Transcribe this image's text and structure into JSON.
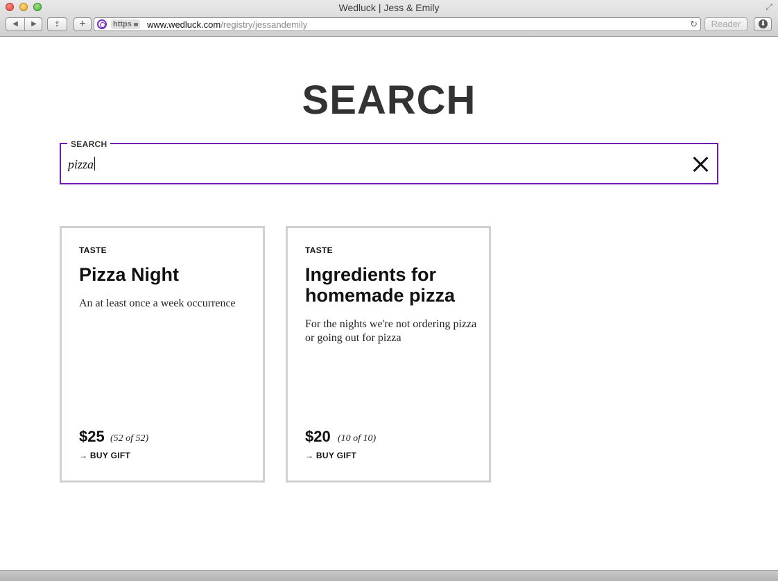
{
  "window": {
    "title": "Wedluck | Jess & Emily"
  },
  "toolbar": {
    "back_icon": "◀",
    "forward_icon": "▶",
    "share_icon": "⇪",
    "add_icon": "+",
    "https_label": "https",
    "url_host": "www.wedluck.com",
    "url_path": "/registry/jessandemily",
    "reload_icon": "↻",
    "reader_label": "Reader",
    "download_icon": "⬇",
    "fullscreen_icon": "⤢"
  },
  "page": {
    "heading": "SEARCH"
  },
  "search": {
    "label": "SEARCH",
    "value": "pizza",
    "accent_color": "#6e19b0"
  },
  "results": [
    {
      "category": "TASTE",
      "title": "Pizza Night",
      "description": "An at least once a week occurrence",
      "price": "$25",
      "count": "(52 of 52)",
      "action": "→ BUY GIFT"
    },
    {
      "category": "TASTE",
      "title": "Ingredients for homemade pizza",
      "description": "For the nights we're not ordering pizza or going out for pizza",
      "price": "$20",
      "count": "(10 of 10)",
      "action": "→ BUY GIFT"
    }
  ]
}
